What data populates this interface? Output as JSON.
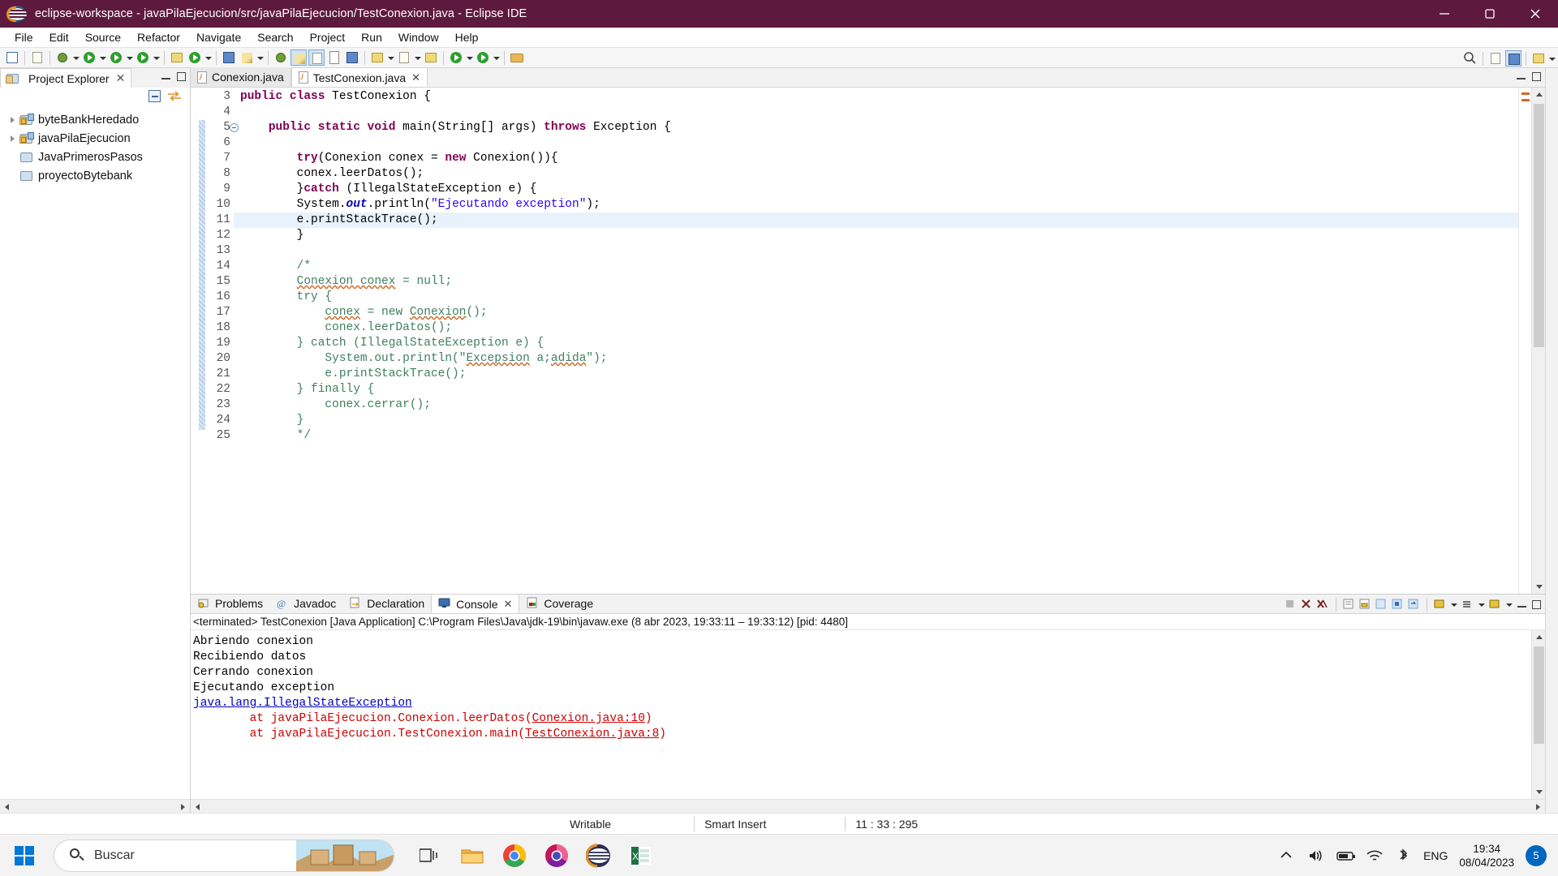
{
  "window": {
    "title": "eclipse-workspace - javaPilaEjecucion/src/javaPilaEjecucion/TestConexion.java - Eclipse IDE",
    "titlebar_color": "#5d1a3e",
    "minimize": "—",
    "maximize": "❐",
    "close": "✕"
  },
  "menu": [
    {
      "label": "File"
    },
    {
      "label": "Edit"
    },
    {
      "label": "Source"
    },
    {
      "label": "Refactor"
    },
    {
      "label": "Navigate"
    },
    {
      "label": "Search"
    },
    {
      "label": "Project"
    },
    {
      "label": "Run"
    },
    {
      "label": "Window"
    },
    {
      "label": "Help"
    }
  ],
  "explorer": {
    "tab_label": "Project Explorer",
    "close_label": "✕",
    "tools": [
      {
        "name": "collapse-all-icon"
      },
      {
        "name": "link-with-editor-icon"
      }
    ],
    "projects": [
      {
        "label": "byteBankHeredado",
        "expandable": true,
        "kind": "java"
      },
      {
        "label": "javaPilaEjecucion",
        "expandable": true,
        "kind": "java"
      },
      {
        "label": "JavaPrimerosPasos",
        "expandable": false,
        "kind": "plain"
      },
      {
        "label": "proyectoBytebank",
        "expandable": false,
        "kind": "plain"
      }
    ]
  },
  "editor": {
    "tabs": [
      {
        "label": "Conexion.java",
        "active": false,
        "closable": false
      },
      {
        "label": "TestConexion.java",
        "active": true,
        "closable": true,
        "close_label": "✕"
      }
    ],
    "first_line": 3,
    "highlighted_line": 11,
    "lines": [
      {
        "n": 3,
        "fold": false,
        "segments": [
          {
            "t": "public class ",
            "c": "kw"
          },
          {
            "t": "TestConexion {",
            "c": ""
          }
        ]
      },
      {
        "n": 4,
        "fold": false,
        "segments": []
      },
      {
        "n": 5,
        "fold": true,
        "segments": [
          {
            "t": "    ",
            "c": ""
          },
          {
            "t": "public static void ",
            "c": "kw"
          },
          {
            "t": "main(String[] args) ",
            "c": ""
          },
          {
            "t": "throws ",
            "c": "kw"
          },
          {
            "t": "Exception {",
            "c": ""
          }
        ]
      },
      {
        "n": 6,
        "fold": false,
        "segments": []
      },
      {
        "n": 7,
        "fold": false,
        "segments": [
          {
            "t": "        ",
            "c": ""
          },
          {
            "t": "try",
            "c": "kw"
          },
          {
            "t": "(Conexion conex = ",
            "c": ""
          },
          {
            "t": "new",
            "c": "kw"
          },
          {
            "t": " Conexion()){",
            "c": ""
          }
        ]
      },
      {
        "n": 8,
        "fold": false,
        "segments": [
          {
            "t": "        conex.leerDatos();",
            "c": ""
          }
        ]
      },
      {
        "n": 9,
        "fold": false,
        "segments": [
          {
            "t": "        }",
            "c": ""
          },
          {
            "t": "catch",
            "c": "kw"
          },
          {
            "t": " (IllegalStateException e) {",
            "c": ""
          }
        ]
      },
      {
        "n": 10,
        "fold": false,
        "segments": [
          {
            "t": "        System.",
            "c": ""
          },
          {
            "t": "out",
            "c": "fld"
          },
          {
            "t": ".println(",
            "c": ""
          },
          {
            "t": "\"Ejecutando exception\"",
            "c": "str"
          },
          {
            "t": ");",
            "c": ""
          }
        ]
      },
      {
        "n": 11,
        "fold": false,
        "segments": [
          {
            "t": "        e.printStackTrace();",
            "c": ""
          }
        ]
      },
      {
        "n": 12,
        "fold": false,
        "segments": [
          {
            "t": "        }",
            "c": ""
          }
        ]
      },
      {
        "n": 13,
        "fold": false,
        "segments": []
      },
      {
        "n": 14,
        "fold": false,
        "segments": [
          {
            "t": "        /*",
            "c": "cmt"
          }
        ]
      },
      {
        "n": 15,
        "fold": false,
        "segments": [
          {
            "t": "        ",
            "c": "cmt"
          },
          {
            "t": "Conexion conex",
            "c": "cmt sq"
          },
          {
            "t": " = null;",
            "c": "cmt"
          }
        ]
      },
      {
        "n": 16,
        "fold": false,
        "segments": [
          {
            "t": "        try {",
            "c": "cmt"
          }
        ]
      },
      {
        "n": 17,
        "fold": false,
        "segments": [
          {
            "t": "            ",
            "c": "cmt"
          },
          {
            "t": "conex",
            "c": "cmt sq"
          },
          {
            "t": " = new ",
            "c": "cmt"
          },
          {
            "t": "Conexion",
            "c": "cmt sq"
          },
          {
            "t": "();",
            "c": "cmt"
          }
        ]
      },
      {
        "n": 18,
        "fold": false,
        "segments": [
          {
            "t": "            conex.leerDatos();",
            "c": "cmt"
          }
        ]
      },
      {
        "n": 19,
        "fold": false,
        "segments": [
          {
            "t": "        } catch (IllegalStateException e) {",
            "c": "cmt"
          }
        ]
      },
      {
        "n": 20,
        "fold": false,
        "segments": [
          {
            "t": "            System.out.println(\"",
            "c": "cmt"
          },
          {
            "t": "Excepsion",
            "c": "cmt sq"
          },
          {
            "t": " a;",
            "c": "cmt"
          },
          {
            "t": "adida",
            "c": "cmt sq"
          },
          {
            "t": "\");",
            "c": "cmt"
          }
        ]
      },
      {
        "n": 21,
        "fold": false,
        "segments": [
          {
            "t": "            e.printStackTrace();",
            "c": "cmt"
          }
        ]
      },
      {
        "n": 22,
        "fold": false,
        "segments": [
          {
            "t": "        } finally {",
            "c": "cmt"
          }
        ]
      },
      {
        "n": 23,
        "fold": false,
        "segments": [
          {
            "t": "            conex.cerrar();",
            "c": "cmt"
          }
        ]
      },
      {
        "n": 24,
        "fold": false,
        "segments": [
          {
            "t": "        }",
            "c": "cmt"
          }
        ]
      },
      {
        "n": 25,
        "fold": false,
        "segments": [
          {
            "t": "        */",
            "c": "cmt"
          }
        ]
      }
    ]
  },
  "bottom_panel": {
    "tabs": [
      {
        "label": "Problems",
        "icon": "problems-icon",
        "active": false
      },
      {
        "label": "Javadoc",
        "icon": "javadoc-icon",
        "active": false
      },
      {
        "label": "Declaration",
        "icon": "declaration-icon",
        "active": false
      },
      {
        "label": "Console",
        "icon": "console-icon",
        "active": true,
        "close_label": "✕"
      },
      {
        "label": "Coverage",
        "icon": "coverage-icon",
        "active": false
      }
    ],
    "console_header": "<terminated> TestConexion [Java Application] C:\\Program Files\\Java\\jdk-19\\bin\\javaw.exe  (8 abr 2023, 19:33:11 – 19:33:12) [pid: 4480]",
    "console_lines": [
      {
        "parts": [
          {
            "t": "Abriendo conexion",
            "c": ""
          }
        ]
      },
      {
        "parts": [
          {
            "t": "Recibiendo datos",
            "c": ""
          }
        ]
      },
      {
        "parts": [
          {
            "t": "Cerrando conexion",
            "c": ""
          }
        ]
      },
      {
        "parts": [
          {
            "t": "Ejecutando exception",
            "c": ""
          }
        ]
      },
      {
        "parts": [
          {
            "t": "java.lang.IllegalStateException",
            "c": "cn-link"
          }
        ]
      },
      {
        "parts": [
          {
            "t": "\tat javaPilaEjecucion.Conexion.leerDatos(",
            "c": "cn-trace"
          },
          {
            "t": "Conexion.java:10",
            "c": "cn-trace cn-link"
          },
          {
            "t": ")",
            "c": "cn-trace"
          }
        ]
      },
      {
        "parts": [
          {
            "t": "\tat javaPilaEjecucion.TestConexion.main(",
            "c": "cn-trace"
          },
          {
            "t": "TestConexion.java:8",
            "c": "cn-trace cn-link"
          },
          {
            "t": ")",
            "c": "cn-trace"
          }
        ]
      }
    ]
  },
  "statusbar": {
    "writable": "Writable",
    "insert_mode": "Smart Insert",
    "position": "11 : 33 : 295"
  },
  "taskbar": {
    "search_placeholder": "Buscar",
    "apps": [
      {
        "name": "task-view",
        "accent": "#3a3a3a"
      },
      {
        "name": "file-explorer",
        "accent": "#e8a93a"
      },
      {
        "name": "chrome",
        "accent": "#4285f4"
      },
      {
        "name": "chrome-canary",
        "accent": "#ea4335"
      },
      {
        "name": "eclipse",
        "accent": "#2c2c54"
      },
      {
        "name": "excel",
        "accent": "#1d7044"
      }
    ],
    "language": "ENG",
    "time": "19:34",
    "date": "08/04/2023",
    "notification_count": "5"
  }
}
